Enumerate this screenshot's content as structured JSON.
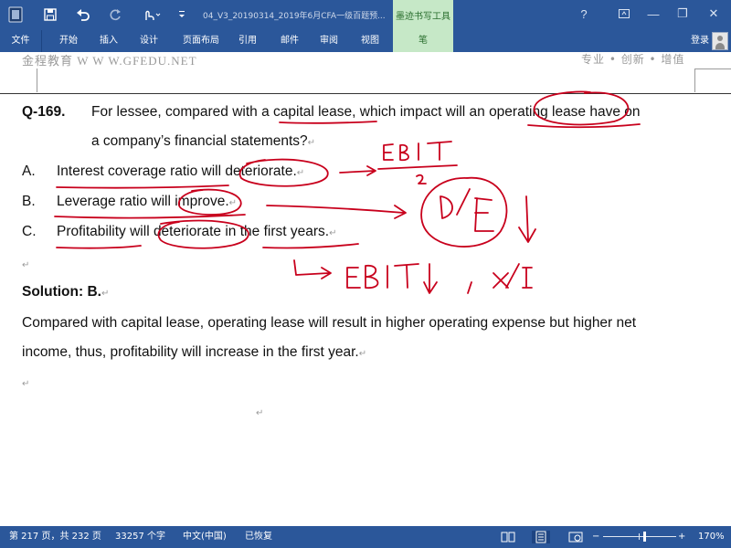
{
  "window": {
    "title": "04_V3_20190314_2019年6月CFA一级百题预...",
    "contextual_tab_group": "墨迹书写工具",
    "controls": {
      "help": "?",
      "restore_ribbon": "▭",
      "minimize": "—",
      "restore": "❐",
      "close": "✕"
    }
  },
  "quick_access": {
    "icons": [
      "word-app-icon",
      "save-icon",
      "undo-icon",
      "redo-icon",
      "touch-mode-icon",
      "customize-icon"
    ]
  },
  "ribbon": {
    "tabs": [
      "文件",
      "开始",
      "插入",
      "设计",
      "页面布局",
      "引用",
      "邮件",
      "审阅",
      "视图",
      "笔"
    ],
    "sign_in": "登录"
  },
  "document": {
    "header_left": "金程教育 W W W.GFEDU.NET",
    "header_right": "专业 • 创新 • 增值",
    "question": {
      "number": "Q-169.",
      "text_parts": [
        "For lessee, compared with ",
        "a capital lease",
        ", which impact will an ",
        "operating lease",
        " have on"
      ],
      "line2": "a company’s financial statements?"
    },
    "options": [
      {
        "letter": "A.",
        "text": "Interest coverage ratio will deteriorate."
      },
      {
        "letter": "B.",
        "text": "Leverage ratio will improve."
      },
      {
        "letter": "C.",
        "text": "Profitability will deteriorate in the first years."
      }
    ],
    "solution_label": "Solution: B.",
    "explanation_line1": "Compared with capital lease, operating lease will result in higher operating expense but higher net",
    "explanation_line2": "income, thus, profitability will increase in the first year.",
    "ink_annotations": {
      "ebit_fraction": "EBIT / 2",
      "d_over_e": "D/E",
      "ebit_down": "EBIT↓ , x/I"
    },
    "paragraph_mark": "↵"
  },
  "statusbar": {
    "page": "第 217 页，共 232 页",
    "words": "33257 个字",
    "language": "中文(中国)",
    "status": "已恢复",
    "zoom": "170%",
    "zoom_minus": "−",
    "zoom_plus": "+"
  }
}
